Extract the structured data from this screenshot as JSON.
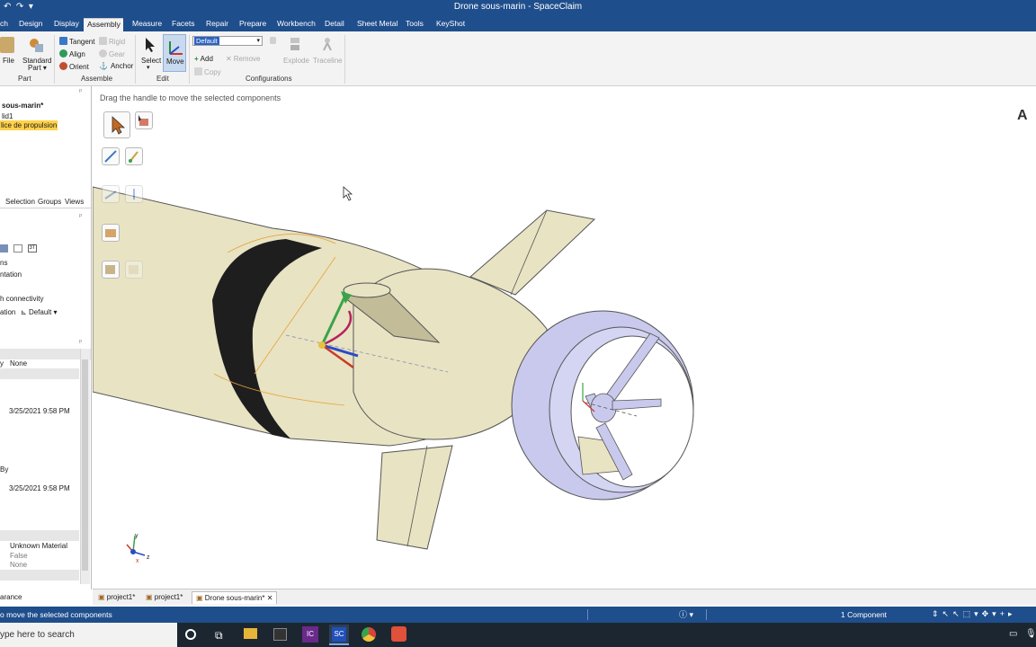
{
  "window": {
    "title": "Drone sous-marin - SpaceClaim"
  },
  "tabs": [
    "ch",
    "Design",
    "Display",
    "Assembly",
    "Measure",
    "Facets",
    "Repair",
    "Prepare",
    "Workbench",
    "Detail",
    "Sheet Metal",
    "Tools",
    "KeyShot"
  ],
  "active_tab": "Assembly",
  "ribbon": {
    "part": {
      "file": "File",
      "standard_part": "Standard",
      "standard_part2": "Part",
      "group": "Part"
    },
    "assemble": {
      "tangent": "Tangent",
      "align": "Align",
      "orient": "Orient",
      "rigid": "Rigid",
      "gear": "Gear",
      "anchor": "Anchor",
      "group": "Assemble"
    },
    "edit": {
      "select": "Select",
      "move": "Move",
      "group": "Edit"
    },
    "configurations": {
      "dropdown_value": "Default",
      "add": "Add",
      "remove": "Remove",
      "copy": "Copy",
      "explode": "Explode",
      "traceline": "Traceline",
      "group": "Configurations"
    }
  },
  "structure": {
    "root": "sous-marin*",
    "solid": "lid1",
    "selected": "lice de propulsion"
  },
  "panel_tabs": {
    "selection": "Selection",
    "groups": "Groups",
    "views": "Views"
  },
  "options": {
    "line1": "ns",
    "line2": "ntation",
    "line3": "h connectivity",
    "line4_label": "ation",
    "line4_value": "Default"
  },
  "properties": {
    "row1_label": "y",
    "row1_value": "None",
    "date1": "3/25/2021 9:58 PM",
    "row_by": "By",
    "date2": "3/25/2021 9:58 PM",
    "material": "Unknown Material",
    "false_value": "False",
    "none_value": "None",
    "appearance": "arance"
  },
  "viewport": {
    "hint": "Drag the handle to move the selected components",
    "corner_letter": "A"
  },
  "doc_tabs": [
    "project1*",
    "project1*",
    "Drone sous-marin*"
  ],
  "status": {
    "left": "o move the selected components",
    "selection_count": "1 Component"
  },
  "taskbar": {
    "search_placeholder": "ype here to search"
  },
  "colors": {
    "ribbon_blue": "#1f4e8c",
    "hull": "#e8e3c3",
    "shroud": "#c8c9ec",
    "band": "#1e1e1e",
    "selection_highlight": "#ffd24a"
  }
}
